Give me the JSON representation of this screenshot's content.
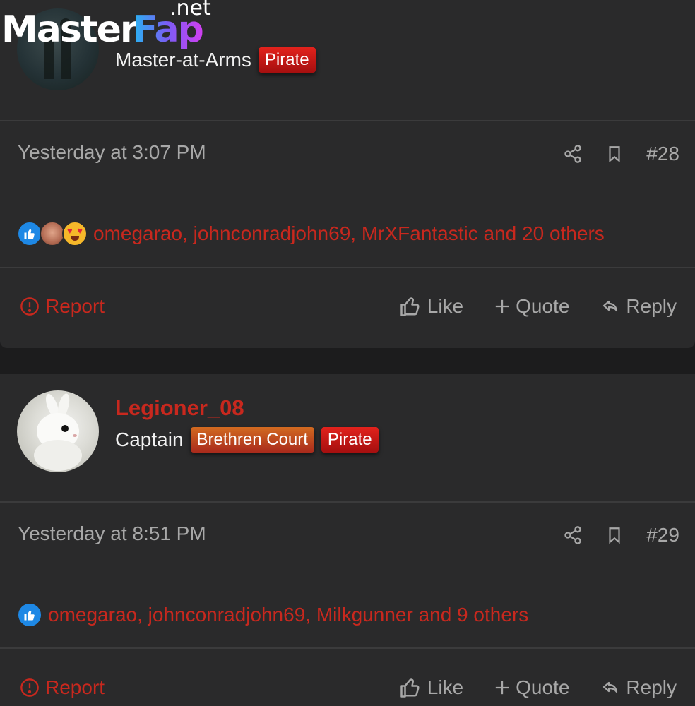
{
  "watermark": {
    "brand_main": "Master",
    "brand_accent": "Fap",
    "brand_suffix": ".net"
  },
  "posts": [
    {
      "username": "",
      "user_title": "Master-at-Arms",
      "badges": [
        "Pirate"
      ],
      "time": "Yesterday at 3:07 PM",
      "post_number": "#28",
      "reactions_text": "omegarao, johnconradjohn69, MrXFantastic and 20 others",
      "actions": {
        "report": "Report",
        "like": "Like",
        "quote": "Quote",
        "reply": "Reply"
      }
    },
    {
      "username": "Legioner_08",
      "user_title": "Captain",
      "badges": [
        "Brethren Court",
        "Pirate"
      ],
      "time": "Yesterday at 8:51 PM",
      "post_number": "#29",
      "reactions_text": "omegarao, johnconradjohn69, Milkgunner and 9 others",
      "actions": {
        "report": "Report",
        "like": "Like",
        "quote": "Quote",
        "reply": "Reply"
      }
    }
  ],
  "colors": {
    "accent_red": "#c8281e",
    "background": "#2a2a2b",
    "muted_text": "#a8a8a8",
    "like_blue": "#1e88e5"
  },
  "icons": [
    "share-icon",
    "bookmark-icon",
    "report-icon",
    "like-icon",
    "quote-plus-icon",
    "reply-icon",
    "like-reaction-icon",
    "heart-eyes-reaction-icon"
  ]
}
